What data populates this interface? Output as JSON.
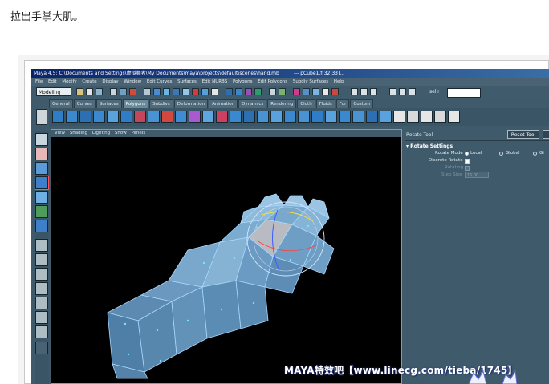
{
  "post": {
    "caption": "拉出手掌大肌。"
  },
  "window": {
    "title": "Maya 4.5: C:\\Documents and Settings\\虚拟舞者\\My Documents\\maya\\projects\\default\\scenes\\hand.mb",
    "title_suffix": "---    pCube1.f[32:33]..."
  },
  "menubar": [
    "File",
    "Edit",
    "Modify",
    "Create",
    "Display",
    "Window",
    "Edit Curves",
    "Surfaces",
    "Edit NURBS",
    "Polygons",
    "Edit Polygons",
    "Subdiv Surfaces",
    "Help"
  ],
  "status_line": {
    "mode": "Modeling",
    "sel_label": "sel+"
  },
  "shelf": {
    "tabs": [
      "General",
      "Curves",
      "Surfaces",
      "Polygons",
      "Subdivs",
      "Deformation",
      "Animation",
      "Dynamics",
      "Rendering",
      "Cloth",
      "Fluids",
      "Fur",
      "Custom"
    ],
    "active_tab": "Polygons"
  },
  "viewport": {
    "menus": [
      "View",
      "Shading",
      "Lighting",
      "Show",
      "Panels"
    ]
  },
  "attribute_editor": {
    "tool_name": "Rotate Tool",
    "reset_button": "Reset Tool",
    "section": "Rotate Settings",
    "rotate_mode_label": "Rotate Mode",
    "options": [
      "Local",
      "Global",
      "Gi"
    ],
    "selected_option": "Local",
    "discrete_rotate_label": "Discrete Rotate",
    "rotating_label": "Rotating",
    "step_size_label": "Step Size",
    "step_size_value": "15.00"
  },
  "watermark": {
    "text": "MAYA特效吧【www.linecg.com/tieba/1745】"
  },
  "colors": {
    "ui_bg": "#3e5a6b",
    "titlebar": "#0a246a",
    "viewport_bg": "#000000",
    "mesh_face": "#5e8fb8",
    "mesh_edge": "#9fd0ff",
    "manipulator_ring": "#c8d8ff",
    "watermark": "#ffffff"
  }
}
